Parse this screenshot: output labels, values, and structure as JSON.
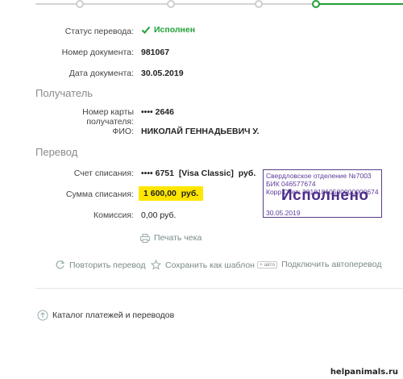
{
  "details": {
    "status_label": "Статус перевода:",
    "status_value": "Исполнен",
    "doc_number_label": "Номер документа:",
    "doc_number_value": "981067",
    "doc_date_label": "Дата документа:",
    "doc_date_value": "30.05.2019"
  },
  "recipient": {
    "section_title": "Получатель",
    "card_label": "Номер карты получателя:",
    "card_value": "•••• 2646",
    "name_label": "ФИО:",
    "name_value": "НИКОЛАЙ ГЕННАДЬЕВИЧ У."
  },
  "transfer": {
    "section_title": "Перевод",
    "account_label": "Счет списания:",
    "account_value": "•••• 6751  [Visa Classic]  руб.",
    "amount_label": "Сумма списания:",
    "amount_value": "1 600,00  руб.",
    "commission_label": "Комиссия:",
    "commission_value": "0,00 руб."
  },
  "stamp": {
    "line1": "Свердловское отделение №7003",
    "line2": "БИК 046577674",
    "line3": "Корр.Счет: 30101810500000000674",
    "big": "Исполнено",
    "date": "30.05.2019"
  },
  "actions": {
    "print": "Печать чека",
    "repeat": "Повторить перевод",
    "save_template": "Сохранить как шаблон",
    "auto_badge": "авто",
    "autotransfer": "Подключить автоперевод",
    "catalog": "Каталог платежей и переводов"
  },
  "watermark": "helpanimals.ru",
  "colors": {
    "accent_green": "#21a038",
    "highlight": "#ffe600",
    "stamp": "#5b3a9a"
  }
}
